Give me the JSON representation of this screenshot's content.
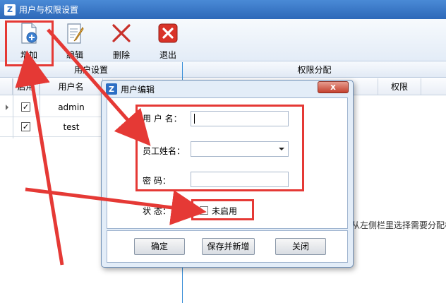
{
  "window": {
    "title": "用户与权限设置"
  },
  "toolbar": {
    "add_label": "增加",
    "edit_label": "编辑",
    "delete_label": "删除",
    "exit_label": "退出"
  },
  "left_panel": {
    "header": "用户设置",
    "columns": [
      "启用",
      "用户名"
    ],
    "rows": [
      {
        "enabled": true,
        "name": "admin"
      },
      {
        "enabled": true,
        "name": "test"
      }
    ]
  },
  "right_panel": {
    "header": "权限分配",
    "column": "权限",
    "hint": "从左侧栏里选择需要分配权"
  },
  "dialog": {
    "title": "用户编辑",
    "close_label": "x",
    "username_label": "用 户 名：",
    "username_value": "",
    "employee_label": "员工姓名：",
    "employee_value": "",
    "password_label": "密      码：",
    "password_value": "",
    "status_label": "状      态：",
    "status_checkbox_label": "未启用",
    "status_checked": false,
    "confirm_label": "确定",
    "save_new_label": "保存并新增",
    "close_button_label": "关闭"
  },
  "colors": {
    "title_bar": "#2d68b8",
    "annotation_red": "#e53935",
    "divider_blue": "#3a8fd8"
  }
}
